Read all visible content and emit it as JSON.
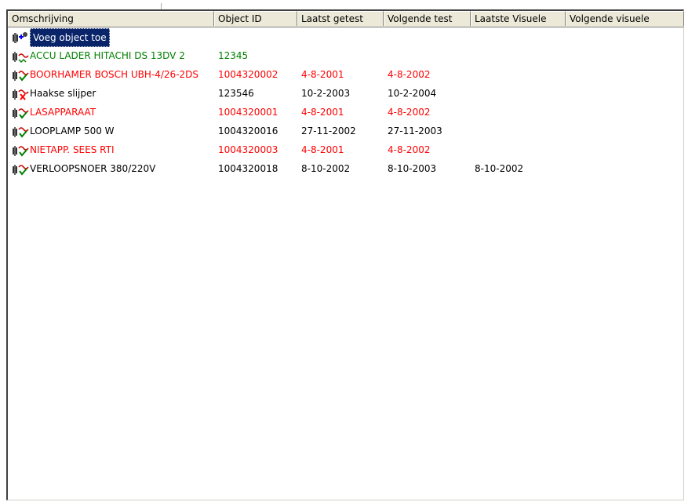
{
  "colors": {
    "red": "#ff0000",
    "green": "#008000",
    "black": "#000000",
    "selection": "#0a246a"
  },
  "columns": [
    "Omschrijving",
    "Object ID",
    "Laatst getest",
    "Volgende test",
    "Laatste Visuele",
    "Volgende visuele"
  ],
  "rows": [
    {
      "name": "Voeg object toe",
      "id": "",
      "last": "",
      "next": "",
      "lastvis": "",
      "nextvis": "",
      "icon": "add-object-icon"
    },
    {
      "name": "ACCU LADER HITACHI DS 13DV 2",
      "id": "12345",
      "last": "",
      "next": "",
      "lastvis": "",
      "nextvis": "",
      "icon": "plug-pending-icon"
    },
    {
      "name": "BOORHAMER BOSCH UBH-4/26-2DS",
      "id": "1004320002",
      "last": "4-8-2001",
      "next": "4-8-2002",
      "lastvis": "",
      "nextvis": "",
      "icon": "plug-approved-icon"
    },
    {
      "name": "Haakse slijper",
      "id": "123546",
      "last": "10-2-2003",
      "next": "10-2-2004",
      "lastvis": "",
      "nextvis": "",
      "icon": "plug-rejected-icon"
    },
    {
      "name": "LASAPPARAAT",
      "id": "1004320001",
      "last": "4-8-2001",
      "next": "4-8-2002",
      "lastvis": "",
      "nextvis": "",
      "icon": "plug-approved-icon"
    },
    {
      "name": "LOOPLAMP 500 W",
      "id": "1004320016",
      "last": "27-11-2002",
      "next": "27-11-2003",
      "lastvis": "",
      "nextvis": "",
      "icon": "plug-approved-icon"
    },
    {
      "name": "NIETAPP. SEES RTI",
      "id": "1004320003",
      "last": "4-8-2001",
      "next": "4-8-2002",
      "lastvis": "",
      "nextvis": "",
      "icon": "plug-approved-icon"
    },
    {
      "name": "VERLOOPSNOER 380/220V",
      "id": "1004320018",
      "last": "8-10-2002",
      "next": "8-10-2003",
      "lastvis": "8-10-2002",
      "nextvis": "",
      "icon": "plug-approved-icon"
    }
  ]
}
